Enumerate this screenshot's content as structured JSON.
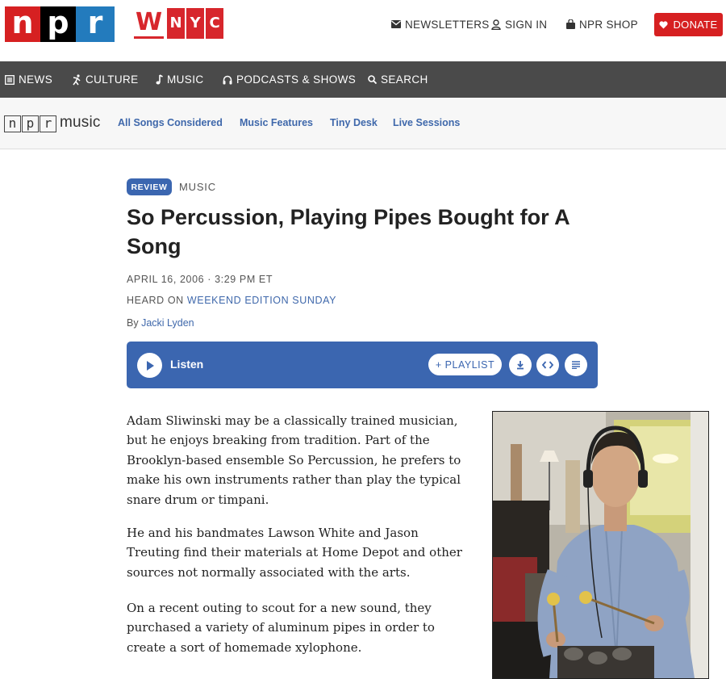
{
  "header": {
    "npr_logo": [
      "n",
      "p",
      "r"
    ],
    "wnyc_logo": [
      "W",
      "N",
      "Y",
      "C"
    ],
    "utility": [
      {
        "label": "NEWSLETTERS",
        "icon": "envelope-icon"
      },
      {
        "label": "SIGN IN",
        "icon": "user-icon"
      },
      {
        "label": "NPR SHOP",
        "icon": "shopping-bag-icon"
      }
    ],
    "donate_label": "DONATE"
  },
  "nav": {
    "items": [
      {
        "label": "NEWS",
        "icon": "newspaper-icon"
      },
      {
        "label": "CULTURE",
        "icon": "dancer-icon"
      },
      {
        "label": "MUSIC",
        "icon": "music-note-icon"
      },
      {
        "label": "PODCASTS & SHOWS",
        "icon": "headphones-icon"
      },
      {
        "label": "SEARCH",
        "icon": "search-icon"
      }
    ]
  },
  "subnav": {
    "logo_letters": [
      "n",
      "p",
      "r"
    ],
    "brand": "music",
    "links": [
      "All Songs Considered",
      "Music Features",
      "Tiny Desk",
      "Live Sessions"
    ]
  },
  "article": {
    "badge": "REVIEW",
    "section": "MUSIC",
    "headline": "So Percussion, Playing Pipes Bought for A Song",
    "date": "APRIL 16, 2006 · 3:29 PM ET",
    "heard_on_prefix": "HEARD ON",
    "heard_on_show": "WEEKEND EDITION SUNDAY",
    "byline_prefix": "By",
    "author": "Jacki Lyden",
    "paragraphs": [
      "Adam Sliwinski may be a classically trained musician, but he enjoys breaking from tradition. Part of the Brooklyn-based ensemble So Percussion, he prefers to make his own instruments rather than play the typical snare drum or timpani.",
      "He and his bandmates Lawson White and Jason Treuting find their materials at Home Depot and other sources not normally associated with the arts.",
      "On a recent outing to scout for a new sound, they purchased a variety of aluminum pipes in order to create a sort of homemade xylophone."
    ]
  },
  "player": {
    "listen_label": "Listen",
    "playlist_label": "+ PLAYLIST"
  },
  "colors": {
    "npr_red": "#d62021",
    "npr_blue": "#237bbd",
    "accent_blue": "#3b66b0",
    "nav_gray": "#4a4a4a"
  }
}
